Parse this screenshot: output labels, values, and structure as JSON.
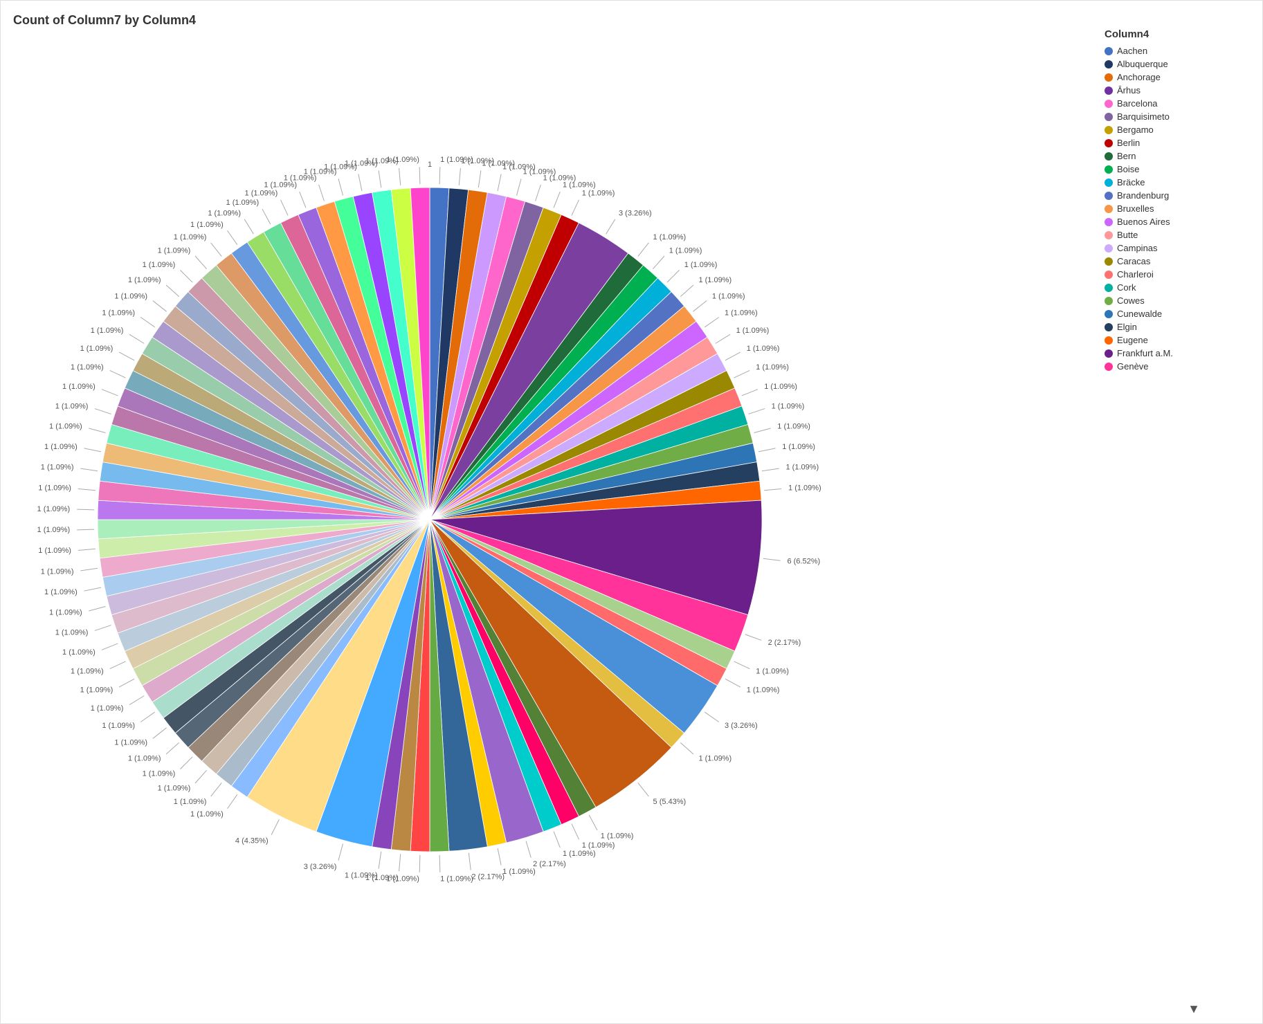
{
  "title": "Count of Column7 by Column4",
  "legend": {
    "title": "Column4",
    "items": [
      {
        "label": "Aachen",
        "color": "#4472C4"
      },
      {
        "label": "Albuquerque",
        "color": "#1F3864"
      },
      {
        "label": "Anchorage",
        "color": "#E36C09"
      },
      {
        "label": "Ārhus",
        "color": "#7030A0"
      },
      {
        "label": "Barcelona",
        "color": "#FF66CC"
      },
      {
        "label": "Barquisimeto",
        "color": "#8064A2"
      },
      {
        "label": "Bergamo",
        "color": "#C4A000"
      },
      {
        "label": "Berlin",
        "color": "#C00000"
      },
      {
        "label": "Bern",
        "color": "#1F6B3A"
      },
      {
        "label": "Boise",
        "color": "#00B050"
      },
      {
        "label": "Bräcke",
        "color": "#00B0D8"
      },
      {
        "label": "Brandenburg",
        "color": "#5472C4"
      },
      {
        "label": "Bruxelles",
        "color": "#F79646"
      },
      {
        "label": "Buenos Aires",
        "color": "#CC66FF"
      },
      {
        "label": "Butte",
        "color": "#FF9999"
      },
      {
        "label": "Campinas",
        "color": "#CCAAFF"
      },
      {
        "label": "Caracas",
        "color": "#998800"
      },
      {
        "label": "Charleroi",
        "color": "#FF7070"
      },
      {
        "label": "Cork",
        "color": "#00B0A0"
      },
      {
        "label": "Cowes",
        "color": "#70AD47"
      },
      {
        "label": "Cunewalde",
        "color": "#2E75B6"
      },
      {
        "label": "Elgin",
        "color": "#243F60"
      },
      {
        "label": "Eugene",
        "color": "#FF6600"
      },
      {
        "label": "Frankfurt a.M.",
        "color": "#6B1F8A"
      },
      {
        "label": "Genève",
        "color": "#FF3399"
      }
    ]
  },
  "slices": [
    {
      "label": "1 (1.09%)",
      "value": 1,
      "color": "#4472C4"
    },
    {
      "label": "1 (1.09%)",
      "value": 1,
      "color": "#1F3864"
    },
    {
      "label": "1 (1.09%)",
      "value": 1,
      "color": "#E36C09"
    },
    {
      "label": "1 (1.09%)",
      "value": 1,
      "color": "#CC99FF"
    },
    {
      "label": "1 (1.09%)",
      "value": 1,
      "color": "#FF66CC"
    },
    {
      "label": "1 (1.09%)",
      "value": 1,
      "color": "#8064A2"
    },
    {
      "label": "1 (1.09%)",
      "value": 1,
      "color": "#C4A000"
    },
    {
      "label": "1 (1.09%)",
      "value": 1,
      "color": "#C00000"
    },
    {
      "label": "3 (3.26%)",
      "value": 3,
      "color": "#7B3FA0"
    },
    {
      "label": "1 (1.09%)",
      "value": 1,
      "color": "#1F6B3A"
    },
    {
      "label": "1 (1.09%)",
      "value": 1,
      "color": "#00B050"
    },
    {
      "label": "1 (1.09%)",
      "value": 1,
      "color": "#00B0D8"
    },
    {
      "label": "1 (1.09%)",
      "value": 1,
      "color": "#5472C4"
    },
    {
      "label": "1 (1.09%)",
      "value": 1,
      "color": "#F79646"
    },
    {
      "label": "1 (1.09%)",
      "value": 1,
      "color": "#CC66FF"
    },
    {
      "label": "1 (1.09%)",
      "value": 1,
      "color": "#FF9999"
    },
    {
      "label": "1 (1.09%)",
      "value": 1,
      "color": "#CCAAFF"
    },
    {
      "label": "1 (1.09%)",
      "value": 1,
      "color": "#998800"
    },
    {
      "label": "1 (1.09%)",
      "value": 1,
      "color": "#FF7070"
    },
    {
      "label": "1 (1.09%)",
      "value": 1,
      "color": "#00B0A0"
    },
    {
      "label": "1 (1.09%)",
      "value": 1,
      "color": "#70AD47"
    },
    {
      "label": "1 (1.09%)",
      "value": 1,
      "color": "#2E75B6"
    },
    {
      "label": "1 (1.09%)",
      "value": 1,
      "color": "#243F60"
    },
    {
      "label": "1 (1.09%)",
      "value": 1,
      "color": "#FF6600"
    },
    {
      "label": "6 (6.52%)",
      "value": 6,
      "color": "#6B1F8A"
    },
    {
      "label": "2 (2.17%)",
      "value": 2,
      "color": "#FF3399"
    },
    {
      "label": "1 (1.09%)",
      "value": 1,
      "color": "#A9D18E"
    },
    {
      "label": "1 (1.09%)",
      "value": 1,
      "color": "#FF6B6B"
    },
    {
      "label": "3 (3.26%)",
      "value": 3,
      "color": "#4A90D9"
    },
    {
      "label": "1 (1.09%)",
      "value": 1,
      "color": "#E4BE40"
    },
    {
      "label": "5 (5.43%)",
      "value": 5,
      "color": "#C55A11"
    },
    {
      "label": "1 (1.09%)",
      "value": 1,
      "color": "#538135"
    },
    {
      "label": "1 (1.09%)",
      "value": 1,
      "color": "#FF0066"
    },
    {
      "label": "1 (1.09%)",
      "value": 1,
      "color": "#00CCCC"
    },
    {
      "label": "2 (2.17%)",
      "value": 2,
      "color": "#9966CC"
    },
    {
      "label": "1 (1.09%)",
      "value": 1,
      "color": "#FFCC00"
    },
    {
      "label": "2 (2.17%)",
      "value": 2,
      "color": "#336699"
    },
    {
      "label": "1 (1.09%)",
      "value": 1,
      "color": "#66AA44"
    },
    {
      "label": "1 (1.09%)",
      "value": 1,
      "color": "#FF4444"
    },
    {
      "label": "1 (1.09%)",
      "value": 1,
      "color": "#BB8844"
    },
    {
      "label": "1 (1.09%)",
      "value": 1,
      "color": "#8844BB"
    },
    {
      "label": "3 (3.26%)",
      "value": 3,
      "color": "#44AAFF"
    },
    {
      "label": "4 (4.35%)",
      "value": 4,
      "color": "#FFDD88"
    },
    {
      "label": "1 (1.09%)",
      "value": 1,
      "color": "#88BBFF"
    },
    {
      "label": "1 (1.09%)",
      "value": 1,
      "color": "#AABBCC"
    },
    {
      "label": "1 (1.09%)",
      "value": 1,
      "color": "#CCBBAA"
    },
    {
      "label": "1 (1.09%)",
      "value": 1,
      "color": "#998877"
    },
    {
      "label": "1 (1.09%)",
      "value": 1,
      "color": "#556677"
    },
    {
      "label": "1 (1.09%)",
      "value": 1,
      "color": "#445566"
    },
    {
      "label": "1 (1.09%)",
      "value": 1,
      "color": "#AADDCC"
    },
    {
      "label": "1 (1.09%)",
      "value": 1,
      "color": "#DDAACC"
    },
    {
      "label": "1 (1.09%)",
      "value": 1,
      "color": "#CCDDAA"
    },
    {
      "label": "1 (1.09%)",
      "value": 1,
      "color": "#DDCCAA"
    },
    {
      "label": "1 (1.09%)",
      "value": 1,
      "color": "#BBCCDD"
    },
    {
      "label": "1 (1.09%)",
      "value": 1,
      "color": "#DDBBCC"
    },
    {
      "label": "1 (1.09%)",
      "value": 1,
      "color": "#CCBBDD"
    },
    {
      "label": "1 (1.09%)",
      "value": 1,
      "color": "#AACCEE"
    },
    {
      "label": "1 (1.09%)",
      "value": 1,
      "color": "#EEAACC"
    },
    {
      "label": "1 (1.09%)",
      "value": 1,
      "color": "#CCEEAA"
    },
    {
      "label": "1 (1.09%)",
      "value": 1,
      "color": "#AAEEBB"
    },
    {
      "label": "1 (1.09%)",
      "value": 1,
      "color": "#BB77EE"
    },
    {
      "label": "1 (1.09%)",
      "value": 1,
      "color": "#EE77BB"
    },
    {
      "label": "1 (1.09%)",
      "value": 1,
      "color": "#77BBEE"
    },
    {
      "label": "1 (1.09%)",
      "value": 1,
      "color": "#EEBB77"
    },
    {
      "label": "1 (1.09%)",
      "value": 1,
      "color": "#77EEBB"
    },
    {
      "label": "1 (1.09%)",
      "value": 1,
      "color": "#BB77AA"
    },
    {
      "label": "1 (1.09%)",
      "value": 1,
      "color": "#AA77BB"
    },
    {
      "label": "1 (1.09%)",
      "value": 1,
      "color": "#77AABB"
    },
    {
      "label": "1 (1.09%)",
      "value": 1,
      "color": "#BBAA77"
    },
    {
      "label": "1 (1.09%)",
      "value": 1,
      "color": "#99CCAA"
    },
    {
      "label": "1 (1.09%)",
      "value": 1,
      "color": "#AA99CC"
    },
    {
      "label": "1 (1.09%)",
      "value": 1,
      "color": "#CCAA99"
    },
    {
      "label": "1 (1.09%)",
      "value": 1,
      "color": "#99AACC"
    },
    {
      "label": "1 (1.09%)",
      "value": 1,
      "color": "#CC99AA"
    },
    {
      "label": "1 (1.09%)",
      "value": 1,
      "color": "#AACC99"
    },
    {
      "label": "1 (1.09%)",
      "value": 1,
      "color": "#DD9966"
    },
    {
      "label": "1 (1.09%)",
      "value": 1,
      "color": "#6699DD"
    },
    {
      "label": "1 (1.09%)",
      "value": 1,
      "color": "#99DD66"
    },
    {
      "label": "1 (1.09%)",
      "value": 1,
      "color": "#66DD99"
    },
    {
      "label": "1 (1.09%)",
      "value": 1,
      "color": "#DD6699"
    },
    {
      "label": "1 (1.09%)",
      "value": 1,
      "color": "#9966DD"
    },
    {
      "label": "1 (1.09%)",
      "value": 1,
      "color": "#FF9944"
    },
    {
      "label": "1 (1.09%)",
      "value": 1,
      "color": "#44FF99"
    },
    {
      "label": "1 (1.09%)",
      "value": 1,
      "color": "#9944FF"
    },
    {
      "label": "1 (1.09%)",
      "value": 1,
      "color": "#44FFCC"
    },
    {
      "label": "1 (1.09%)",
      "value": 1,
      "color": "#CCFF44"
    },
    {
      "label": "1 (1.09%)",
      "value": 1,
      "color": "#FF44CC"
    }
  ]
}
